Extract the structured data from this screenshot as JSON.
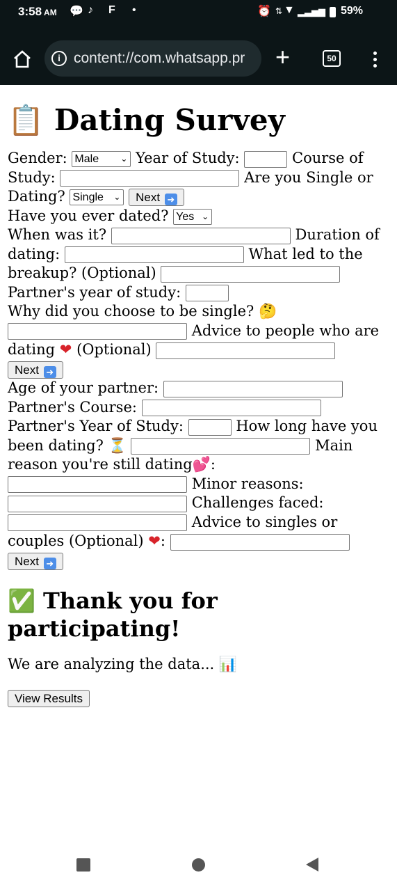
{
  "status": {
    "time": "3:58",
    "ampm": "AM",
    "battery": "59%",
    "icons": [
      "chat-bubble-icon",
      "tiktok-icon",
      "f-icon",
      "dot-icon",
      "alarm-icon",
      "data-arrows-icon",
      "wifi-icon",
      "signal-icon",
      "battery-icon"
    ]
  },
  "browser": {
    "url": "content://com.whatsapp.pr",
    "tabs_count": "50"
  },
  "page": {
    "title": "Dating Survey",
    "title_icon": "📋",
    "form": {
      "gender_label": "Gender:",
      "gender_value": "Male",
      "year_label": "Year of Study:",
      "course_label": "Course of Study:",
      "single_dating_label": "Are you Single or Dating?",
      "single_dating_value": "Single",
      "next_label": "Next",
      "ever_dated_label": "Have you ever dated?",
      "ever_dated_value": "Yes",
      "when_label": "When was it?",
      "duration_label": "Duration of dating:",
      "breakup_label": "What led to the breakup? (Optional)",
      "partner_year_label": "Partner's year of study:",
      "why_single_label": "Why did you choose to be single?",
      "advice_dating_label": "Advice to people who are dating",
      "optional_label": "(Optional)",
      "age_partner_label": "Age of your partner:",
      "partner_course_label": "Partner's Course:",
      "partner_year_of_study_label": "Partner's Year of Study:",
      "how_long_label": "How long have you been dating?",
      "main_reason_label": "Main reason you're still dating",
      "minor_reasons_label": "Minor reasons:",
      "challenges_label": "Challenges faced:",
      "advice_singles_label": "Advice to singles or couples (Optional)"
    },
    "thanks_title": "Thank you for participating!",
    "analyzing_text": "We are analyzing the data...",
    "view_results_label": "View Results"
  }
}
